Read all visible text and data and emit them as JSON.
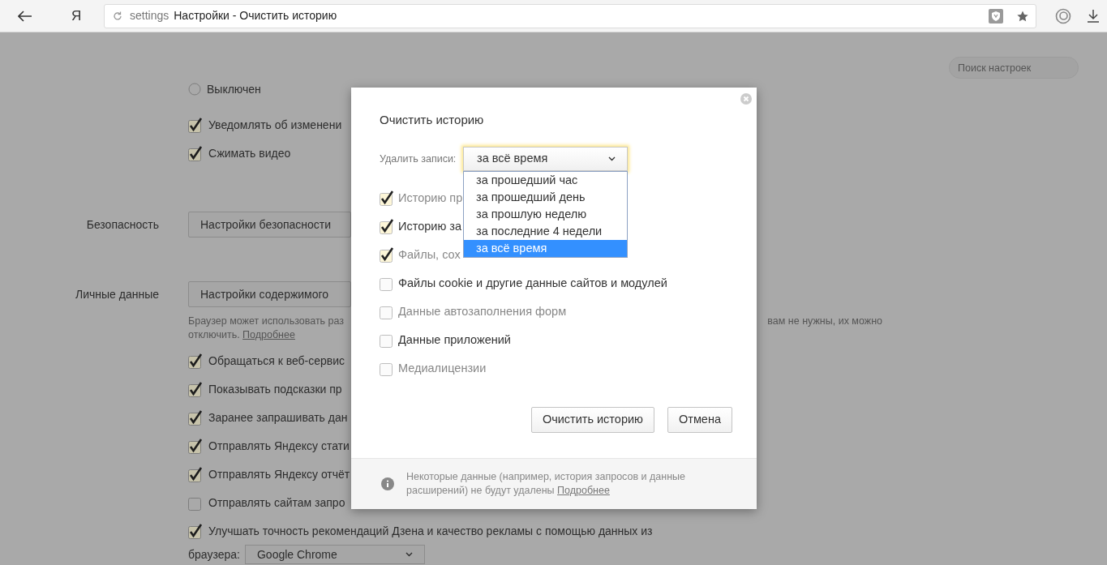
{
  "toolbar": {
    "logo": "Я",
    "address": {
      "scheme": "settings",
      "title": "Настройки - Очистить историю"
    }
  },
  "search": {
    "placeholder": "Поиск настроек"
  },
  "settings": {
    "rows": [
      {
        "kind": "radio",
        "label": "Выключен",
        "checked": false
      },
      {
        "kind": "checkbox",
        "label": "Уведомлять об изменени",
        "checked": true
      },
      {
        "kind": "checkbox",
        "label": "Сжимать видео",
        "checked": true
      },
      {
        "kind": "section",
        "label": "Безопасность",
        "button": "Настройки безопасности"
      },
      {
        "kind": "section",
        "label": "Личные данные",
        "button": "Настройки содержимого"
      },
      {
        "kind": "note",
        "left": "Браузер может использовать раз",
        "right": "вам не нужны, их можно",
        "line2": "отключить.",
        "link": "Подробнее"
      },
      {
        "kind": "checkbox",
        "label": "Обращаться к веб-сервис",
        "checked": true
      },
      {
        "kind": "checkbox",
        "label": "Показывать подсказки пр",
        "checked": true
      },
      {
        "kind": "checkbox",
        "label": "Заранее запрашивать дан",
        "checked": true
      },
      {
        "kind": "checkbox",
        "label": "Отправлять Яндексу стати",
        "checked": true
      },
      {
        "kind": "checkbox",
        "label": "Отправлять Яндексу отчёт",
        "checked": true
      },
      {
        "kind": "checkbox",
        "label": "Отправлять сайтам запро",
        "checked": false
      },
      {
        "kind": "checkbox",
        "label": "Улучшать точность рекомендаций Дзена и качество рекламы с помощью данных из",
        "checked": true
      },
      {
        "kind": "select",
        "label": "браузера:",
        "value": "Google Chrome"
      }
    ]
  },
  "dialog": {
    "title": "Очистить историю",
    "range": {
      "label": "Удалить записи:",
      "value": "за всё время",
      "options": [
        {
          "label": "за прошедший час",
          "selected": false
        },
        {
          "label": "за прошедший день",
          "selected": false
        },
        {
          "label": "за прошлую неделю",
          "selected": false
        },
        {
          "label": "за последние 4 недели",
          "selected": false
        },
        {
          "label": "за всё время",
          "selected": true
        }
      ]
    },
    "items": [
      {
        "label": "Историю пр",
        "checked": true,
        "disabled": true
      },
      {
        "label": "Историю за",
        "checked": true,
        "disabled": false
      },
      {
        "label": "Файлы, сох",
        "checked": true,
        "disabled": true
      },
      {
        "label": "Файлы cookie и другие данные сайтов и модулей",
        "checked": false,
        "disabled": false
      },
      {
        "label": "Данные автозаполнения форм",
        "checked": false,
        "disabled": true
      },
      {
        "label": "Данные приложений",
        "checked": false,
        "disabled": false
      },
      {
        "label": "Медиалицензии",
        "checked": false,
        "disabled": true
      }
    ],
    "buttons": [
      "Очистить историю",
      "Отмена"
    ],
    "footer": {
      "text": "Некоторые данные (например, история запросов и данные расширений) не будут удалены",
      "link": "Подробнее"
    }
  }
}
